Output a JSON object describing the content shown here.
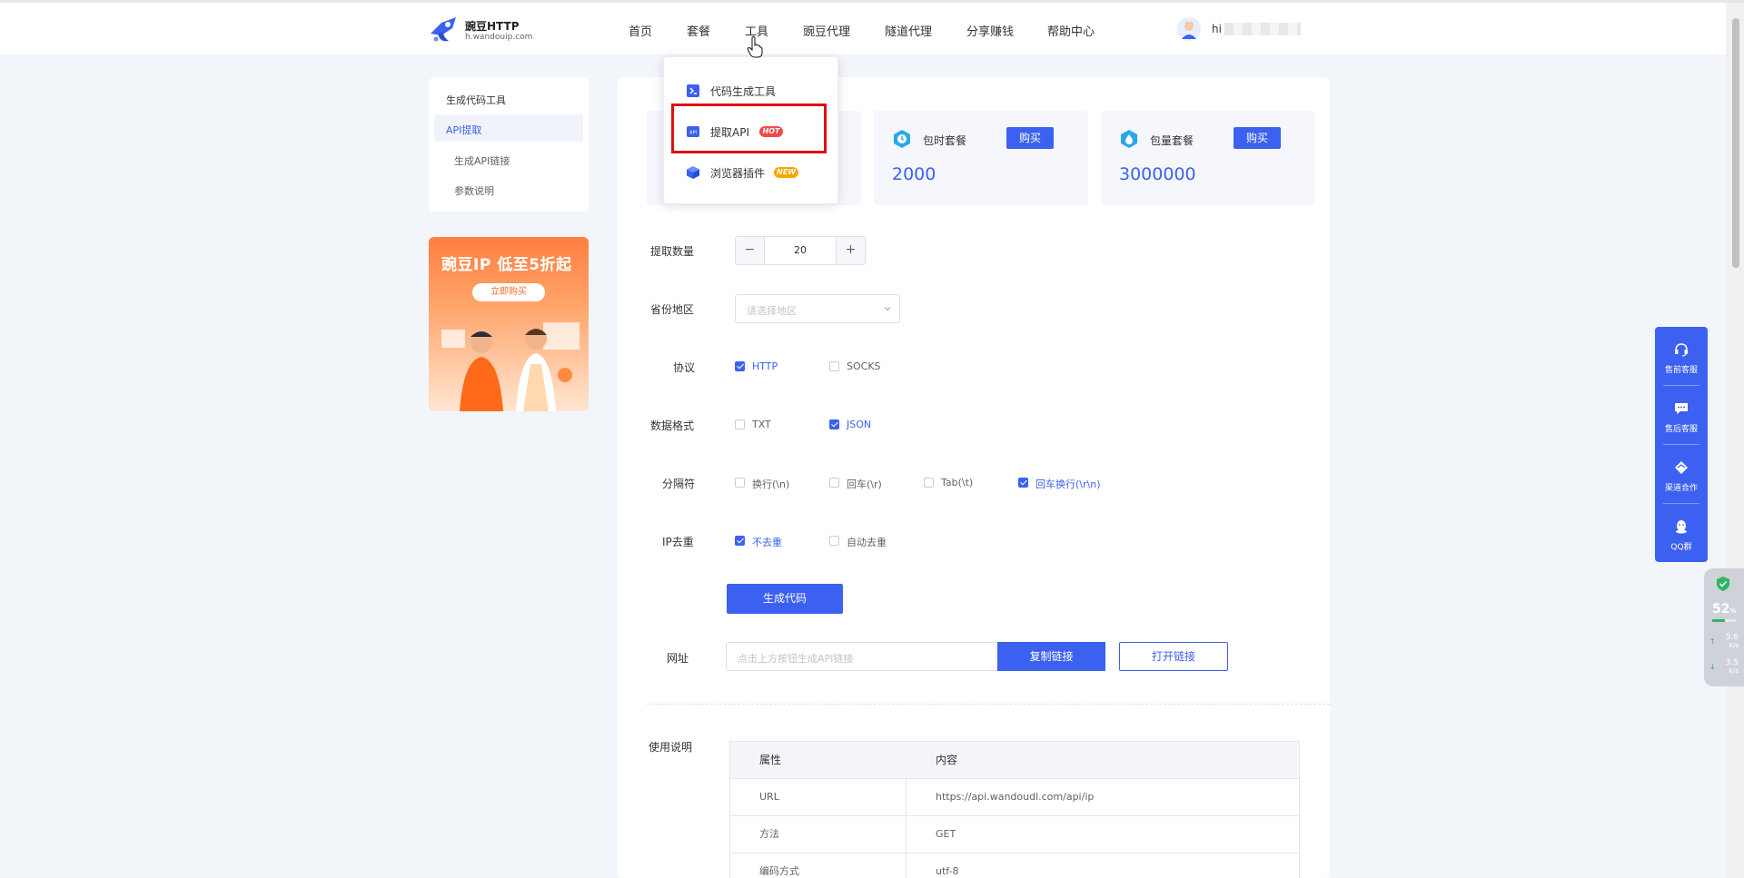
{
  "header": {
    "logo_title": "豌豆HTTP",
    "logo_sub": "h.wandouip.com",
    "nav": [
      "首页",
      "套餐",
      "工具",
      "豌豆代理",
      "隧道代理",
      "分享赚钱",
      "帮助中心"
    ],
    "user_greeting": "hi"
  },
  "dropdown": {
    "items": [
      {
        "label": "代码生成工具",
        "icon": "code-tool-icon"
      },
      {
        "label": "提取API",
        "icon": "api-icon",
        "badge": "HOT"
      },
      {
        "label": "浏览器插件",
        "icon": "browser-plugin-icon",
        "badge": "NEW"
      }
    ]
  },
  "sidebar": {
    "items": [
      {
        "label": "生成代码工具"
      },
      {
        "label": "API提取",
        "active": true
      },
      {
        "label": "生成API链接"
      },
      {
        "label": "参数说明"
      }
    ]
  },
  "banner": {
    "title": "豌豆IP 低至5折起",
    "button": "立即购买"
  },
  "plans": [
    {
      "name": "包时套餐",
      "buy": "购买",
      "value": "2000"
    },
    {
      "name": "包量套餐",
      "buy": "购买",
      "value": "3000000"
    }
  ],
  "form": {
    "quantity_label": "提取数量",
    "quantity_value": "20",
    "minus": "−",
    "plus": "+",
    "region_label": "省份地区",
    "region_placeholder": "请选择地区",
    "protocol_label": "协议",
    "protocol_options": [
      {
        "label": "HTTP",
        "checked": true
      },
      {
        "label": "SOCKS",
        "checked": false
      }
    ],
    "format_label": "数据格式",
    "format_options": [
      {
        "label": "TXT",
        "checked": false
      },
      {
        "label": "JSON",
        "checked": true
      }
    ],
    "separator_label": "分隔符",
    "separator_options": [
      {
        "label": "换行(\\n)",
        "checked": false
      },
      {
        "label": "回车(\\r)",
        "checked": false
      },
      {
        "label": "Tab(\\t)",
        "checked": false
      },
      {
        "label": "回车换行(\\r\\n)",
        "checked": true
      }
    ],
    "dedup_label": "IP去重",
    "dedup_options": [
      {
        "label": "不去重",
        "checked": true
      },
      {
        "label": "自动去重",
        "checked": false
      }
    ],
    "generate_button": "生成代码",
    "url_label": "网址",
    "url_placeholder": "点击上方按钮生成API链接",
    "copy_button": "复制链接",
    "open_button": "打开链接"
  },
  "usage": {
    "label": "使用说明",
    "headers": [
      "属性",
      "内容"
    ],
    "rows": [
      [
        "URL",
        "https://api.wandoudl.com/api/ip"
      ],
      [
        "方法",
        "GET"
      ],
      [
        "编码方式",
        "utf-8"
      ]
    ]
  },
  "float_bar": {
    "items": [
      {
        "label": "售前客服",
        "icon": "headset-icon"
      },
      {
        "label": "售后客服",
        "icon": "chat-icon"
      },
      {
        "label": "渠道合作",
        "icon": "handshake-icon"
      },
      {
        "label": "QQ群",
        "icon": "qq-icon"
      }
    ]
  },
  "net_monitor": {
    "percent": "52",
    "percent_unit": "%",
    "percent_fill": 0.52,
    "up": "5.6",
    "down": "3.5",
    "unit": "K/s"
  },
  "colors": {
    "accent": "#3c61f0",
    "highlight_box": "#e01010",
    "hot_badge": "#f5484a",
    "new_badge": "#ffa300"
  }
}
